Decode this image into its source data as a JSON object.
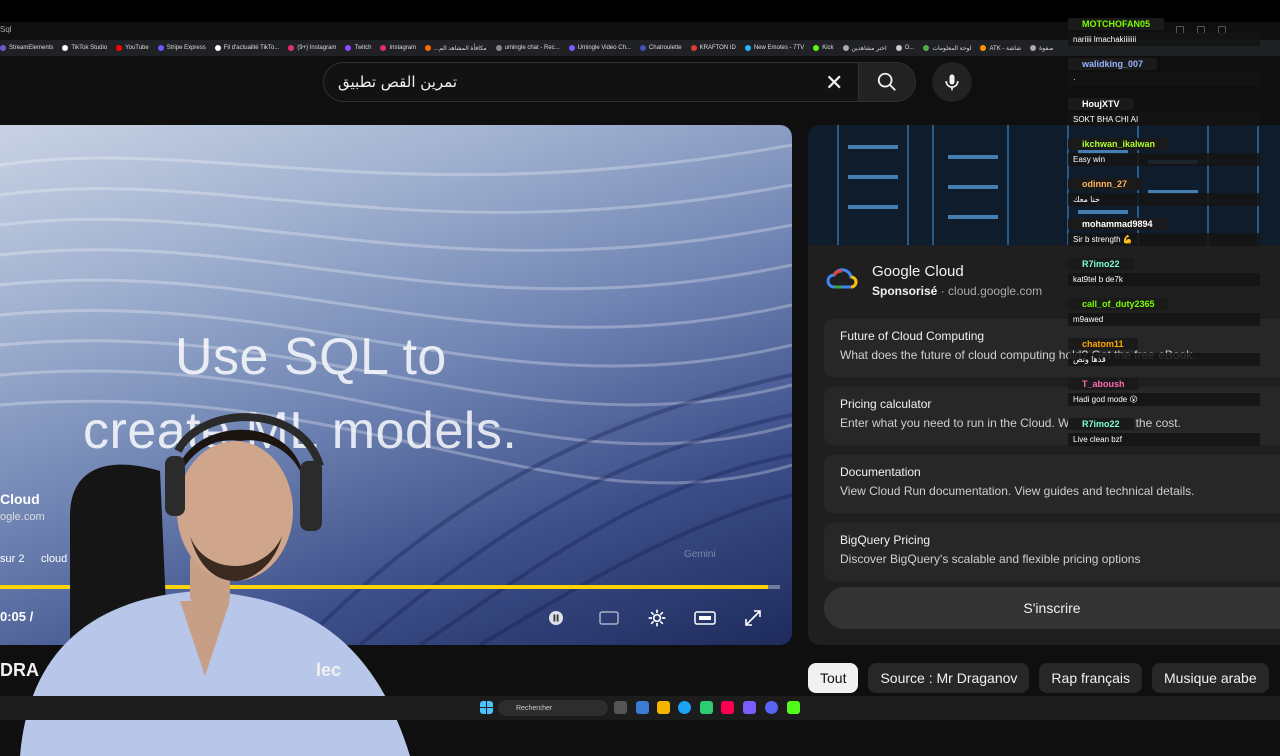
{
  "browser": {
    "tab_title": "Sql",
    "bookmarks": [
      {
        "label": "StreamElements",
        "color": "#6a5acd"
      },
      {
        "label": "TikTok Studio",
        "color": "#ffffff"
      },
      {
        "label": "YouTube",
        "color": "#ff0000"
      },
      {
        "label": "Stripe Express",
        "color": "#635bff"
      },
      {
        "label": "Fil d'actualité TikTo...",
        "color": "#ffffff"
      },
      {
        "label": "(9+) Instagram",
        "color": "#e1306c"
      },
      {
        "label": "Twitch",
        "color": "#9146ff"
      },
      {
        "label": "Instagram",
        "color": "#e1306c"
      },
      {
        "label": "...مكافأة المشاهد الم",
        "color": "#ff6a00"
      },
      {
        "label": "umingle chat - Rec...",
        "color": "#888888"
      },
      {
        "label": "Umingle Video Ch...",
        "color": "#7a5cff"
      },
      {
        "label": "Chatroulette",
        "color": "#3f51b5"
      },
      {
        "label": "KRAFTON ID",
        "color": "#e53935"
      },
      {
        "label": "New Emotes - 7TV",
        "color": "#29b6f6"
      },
      {
        "label": "Kick",
        "color": "#53fc18"
      },
      {
        "label": "اختر مشاهدين",
        "color": "#aaaaaa"
      },
      {
        "label": "O...",
        "color": "#cccccc"
      },
      {
        "label": "لوحة المعلومات",
        "color": "#4caf50"
      },
      {
        "label": "ATK - شاشة",
        "color": "#ff9800"
      },
      {
        "label": "صفوة",
        "color": "#aaaaaa"
      }
    ]
  },
  "search": {
    "value": "تمرين القص تطبيق"
  },
  "icons": {
    "clear": "close-icon",
    "search": "search-icon",
    "mic": "microphone-icon"
  },
  "player": {
    "headline_line1": "Use SQL to",
    "headline_line2": "create ML models.",
    "channel_name": "Cloud",
    "channel_url": "ogle.com",
    "page_counter": "sur 2",
    "tag": "cloud",
    "time": "0:05 /",
    "progress_fraction": 0.985,
    "ghost_text": "Gemini"
  },
  "below_video": {
    "title_left": "DRA",
    "title_right": "lec"
  },
  "ad": {
    "brand": "Google Cloud",
    "sponsored_label": "Sponsorisé",
    "separator": "·",
    "domain": "cloud.google.com",
    "links": [
      {
        "title": "Future of Cloud Computing",
        "desc": "What does the future of cloud computing hold? Get the free eBook."
      },
      {
        "title": "Pricing calculator",
        "desc": "Enter what you need to run in the Cloud. We'll estimate the cost."
      },
      {
        "title": "Documentation",
        "desc": "View Cloud Run documentation. View guides and technical details."
      },
      {
        "title": "BigQuery Pricing",
        "desc": "Discover BigQuery's scalable and flexible pricing options"
      }
    ],
    "subscribe_label": "S'inscrire"
  },
  "chips": [
    {
      "label": "Tout",
      "active": true
    },
    {
      "label": "Source : Mr Draganov",
      "active": false
    },
    {
      "label": "Rap français",
      "active": false
    },
    {
      "label": "Musique arabe",
      "active": false
    }
  ],
  "chat": [
    {
      "user": "MOTCHOFAN05",
      "color": "#7cfc00",
      "text": "nariiii lmachakiiiiiii"
    },
    {
      "user": "walidking_007",
      "color": "#9ab3ff",
      "text": "·"
    },
    {
      "user": "HoujXTV",
      "color": "#ffffff",
      "text": "SOKT BHA CHI AI"
    },
    {
      "user": "ikchwan_ikalwan",
      "color": "#adff2f",
      "text": "Easy win"
    },
    {
      "user": "odinnn_27",
      "color": "#ffb35c",
      "text": "حنا معك"
    },
    {
      "user": "mohammad9894",
      "color": "#ffffff",
      "text": "Sir b strength 💪"
    },
    {
      "user": "R7imo22",
      "color": "#7fffd4",
      "text": "kat9tel b de7k"
    },
    {
      "user": "call_of_duty2365",
      "color": "#7cfc00",
      "text": "m9awed"
    },
    {
      "user": "chatom11",
      "color": "#ffa500",
      "text": "قدها ونص"
    },
    {
      "user": "T_aboush",
      "color": "#ff69b4",
      "text": "Hadi god mode 😮"
    },
    {
      "user": "R7imo22",
      "color": "#7fffd4",
      "text": "Live clean bzf"
    }
  ],
  "taskbar": {
    "search_placeholder": "Rechercher"
  },
  "colors": {
    "accent_progress": "#ffd400",
    "background": "#0f0f0f",
    "panel": "#1f1f1f"
  }
}
